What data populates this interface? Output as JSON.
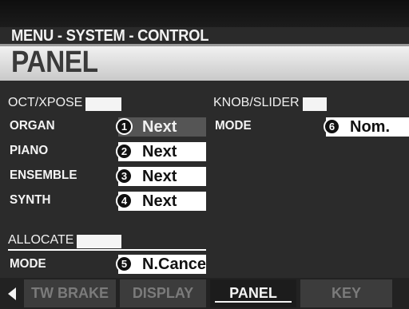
{
  "header": {
    "breadcrumb": "MENU - SYSTEM - CONTROL",
    "page_title": "PANEL"
  },
  "oct_xpose": {
    "section_label": "OCT/XPOSE",
    "rows": [
      {
        "label": "ORGAN",
        "value": "Next",
        "badge": "1",
        "selected": true
      },
      {
        "label": "PIANO",
        "value": "Next",
        "badge": "2"
      },
      {
        "label": "ENSEMBLE",
        "value": "Next",
        "badge": "3"
      },
      {
        "label": "SYNTH",
        "value": "Next",
        "badge": "4"
      }
    ]
  },
  "allocate": {
    "section_label": "ALLOCATE",
    "rows": [
      {
        "label": "MODE",
        "value": "N.Cancel",
        "badge": "5"
      }
    ]
  },
  "knob_slider": {
    "section_label": "KNOB/SLIDER",
    "rows": [
      {
        "label": "MODE",
        "value": "Nom.",
        "badge": "6"
      }
    ]
  },
  "tabs": {
    "items": [
      {
        "label": "TW BRAKE"
      },
      {
        "label": "DISPLAY"
      },
      {
        "label": "PANEL",
        "active": true
      },
      {
        "label": "KEY"
      }
    ]
  },
  "icons": {
    "tab_scroll": "left-arrow-icon"
  },
  "colors": {
    "background": "#2b2b2b",
    "title_band": "#e8e8e8",
    "selected_value_bg": "#555555",
    "value_bg": "#ffffff"
  }
}
